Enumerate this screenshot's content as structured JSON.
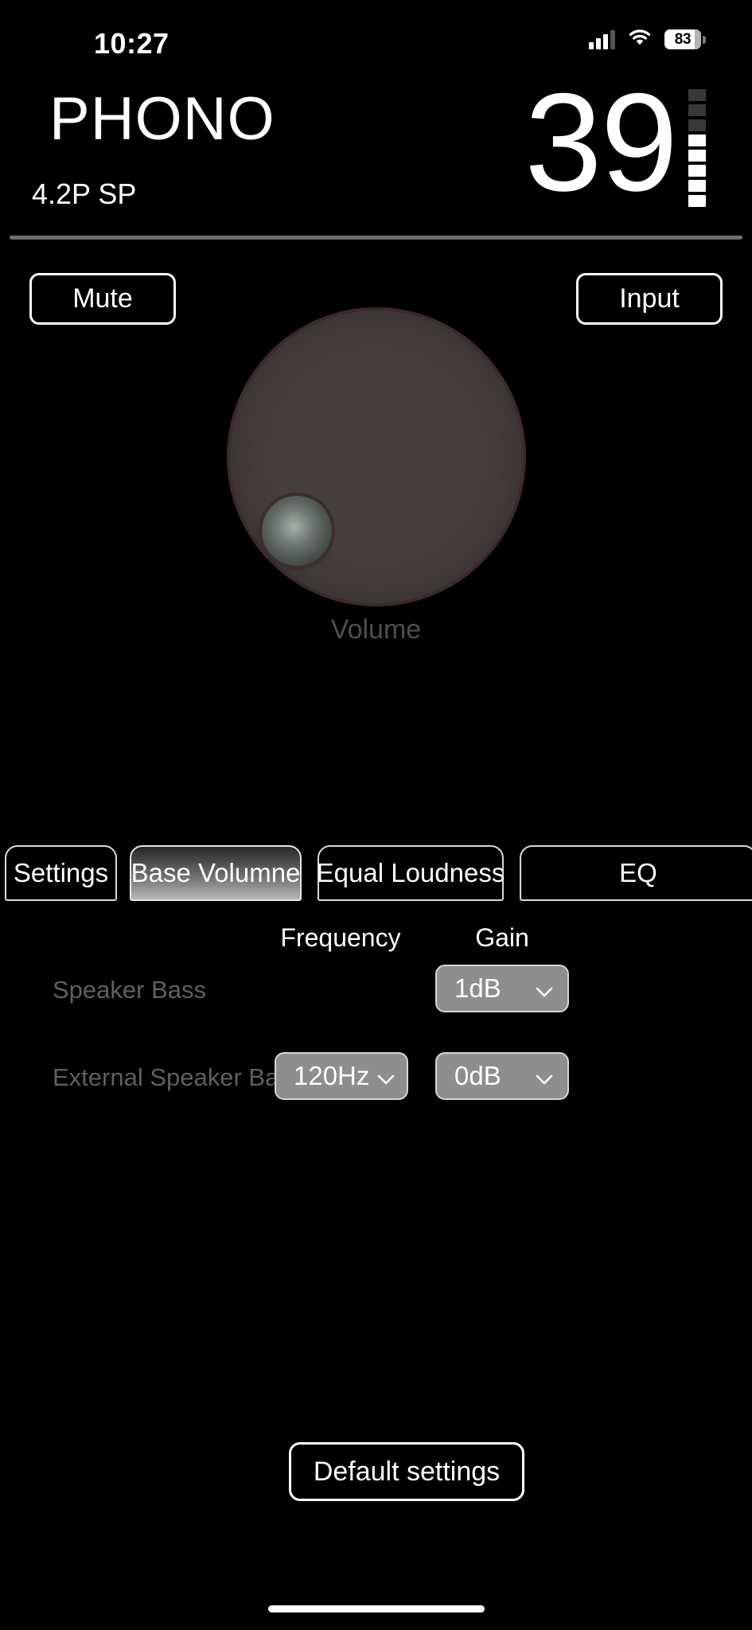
{
  "status_bar": {
    "time": "10:27",
    "battery_percent": "83",
    "cellular_icon": "cellular-signal-icon",
    "wifi_icon": "wifi-icon",
    "battery_icon": "battery-icon"
  },
  "header": {
    "source": "PHONO",
    "format": "4.2P SP",
    "volume_value": "39",
    "level_segments": [
      "off",
      "off",
      "off",
      "on",
      "on",
      "on",
      "on",
      "on"
    ]
  },
  "top_controls": {
    "mute_label": "Mute",
    "input_label": "Input"
  },
  "knob": {
    "label": "Volume",
    "face_color": "#453F3E",
    "rim_color": "#3B2A28",
    "thumb_name": "volume-knob-thumb"
  },
  "tabs": [
    {
      "label": "Settings",
      "selected": false
    },
    {
      "label": "Base Volumne",
      "selected": true
    },
    {
      "label": "Equal Loudness",
      "selected": false
    },
    {
      "label": "EQ",
      "selected": false
    }
  ],
  "table": {
    "columns": [
      "Frequency",
      "Gain"
    ],
    "rows": [
      {
        "label": "Speaker Bass",
        "frequency": "",
        "gain": "1dB",
        "has_frequency": false
      },
      {
        "label": "External Speaker Bass",
        "frequency": "120Hz",
        "gain": "0dB",
        "has_frequency": true
      }
    ]
  },
  "footer": {
    "default_settings_label": "Default settings"
  },
  "colors": {
    "background": "#000000",
    "dropdown_fill": "#8E8E8E",
    "divider": "#6E6E6E",
    "dim_text": "#5F5F5F",
    "knob_label": "#4E4E4E"
  }
}
